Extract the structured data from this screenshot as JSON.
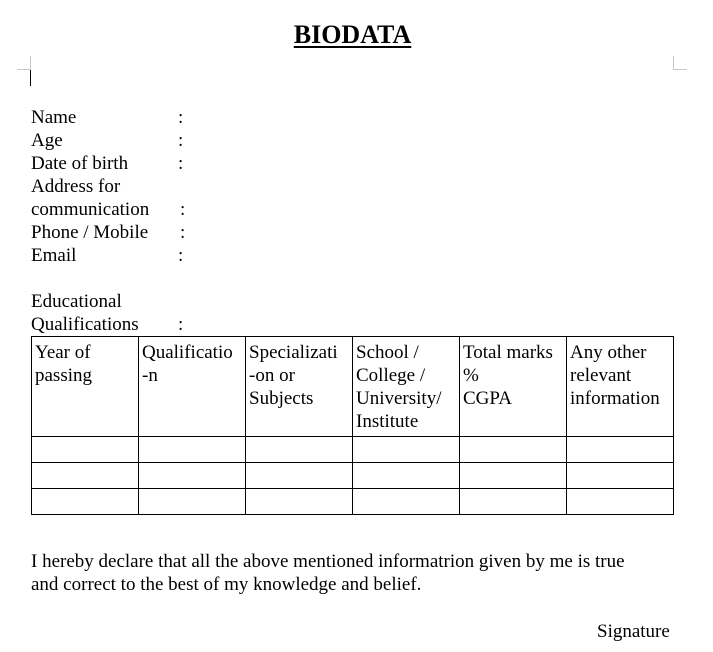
{
  "document": {
    "title": "BIODATA",
    "fields": [
      {
        "label": "Name",
        "colon": ":"
      },
      {
        "label": "Age",
        "colon": ":"
      },
      {
        "label": "Date of birth",
        "colon": ":"
      },
      {
        "label": "Address for",
        "colon": ""
      },
      {
        "label": "communication",
        "colon": ":"
      },
      {
        "label": "Phone / Mobile",
        "colon": ":"
      },
      {
        "label": "Email",
        "colon": ":"
      }
    ],
    "education": {
      "label_line1": "Educational",
      "label_line2": "Qualifications",
      "colon": ":",
      "table": {
        "headers": [
          [
            "Year of",
            "passing"
          ],
          [
            "Qualificatio",
            "-n"
          ],
          [
            "Specializati",
            "-on or",
            "Subjects"
          ],
          [
            "School /",
            "College /",
            "University/",
            "Institute"
          ],
          [
            "Total marks",
            "%",
            "CGPA"
          ],
          [
            "Any other",
            "relevant",
            "information"
          ]
        ],
        "rows": [
          [
            "",
            "",
            "",
            "",
            "",
            ""
          ],
          [
            "",
            "",
            "",
            "",
            "",
            ""
          ],
          [
            "",
            "",
            "",
            "",
            "",
            ""
          ]
        ]
      }
    },
    "declaration_line1": "I hereby declare that all the above mentioned informatrion given by me is true",
    "declaration_line2": "and correct to the best of my knowledge and belief.",
    "signature": "Signature"
  }
}
